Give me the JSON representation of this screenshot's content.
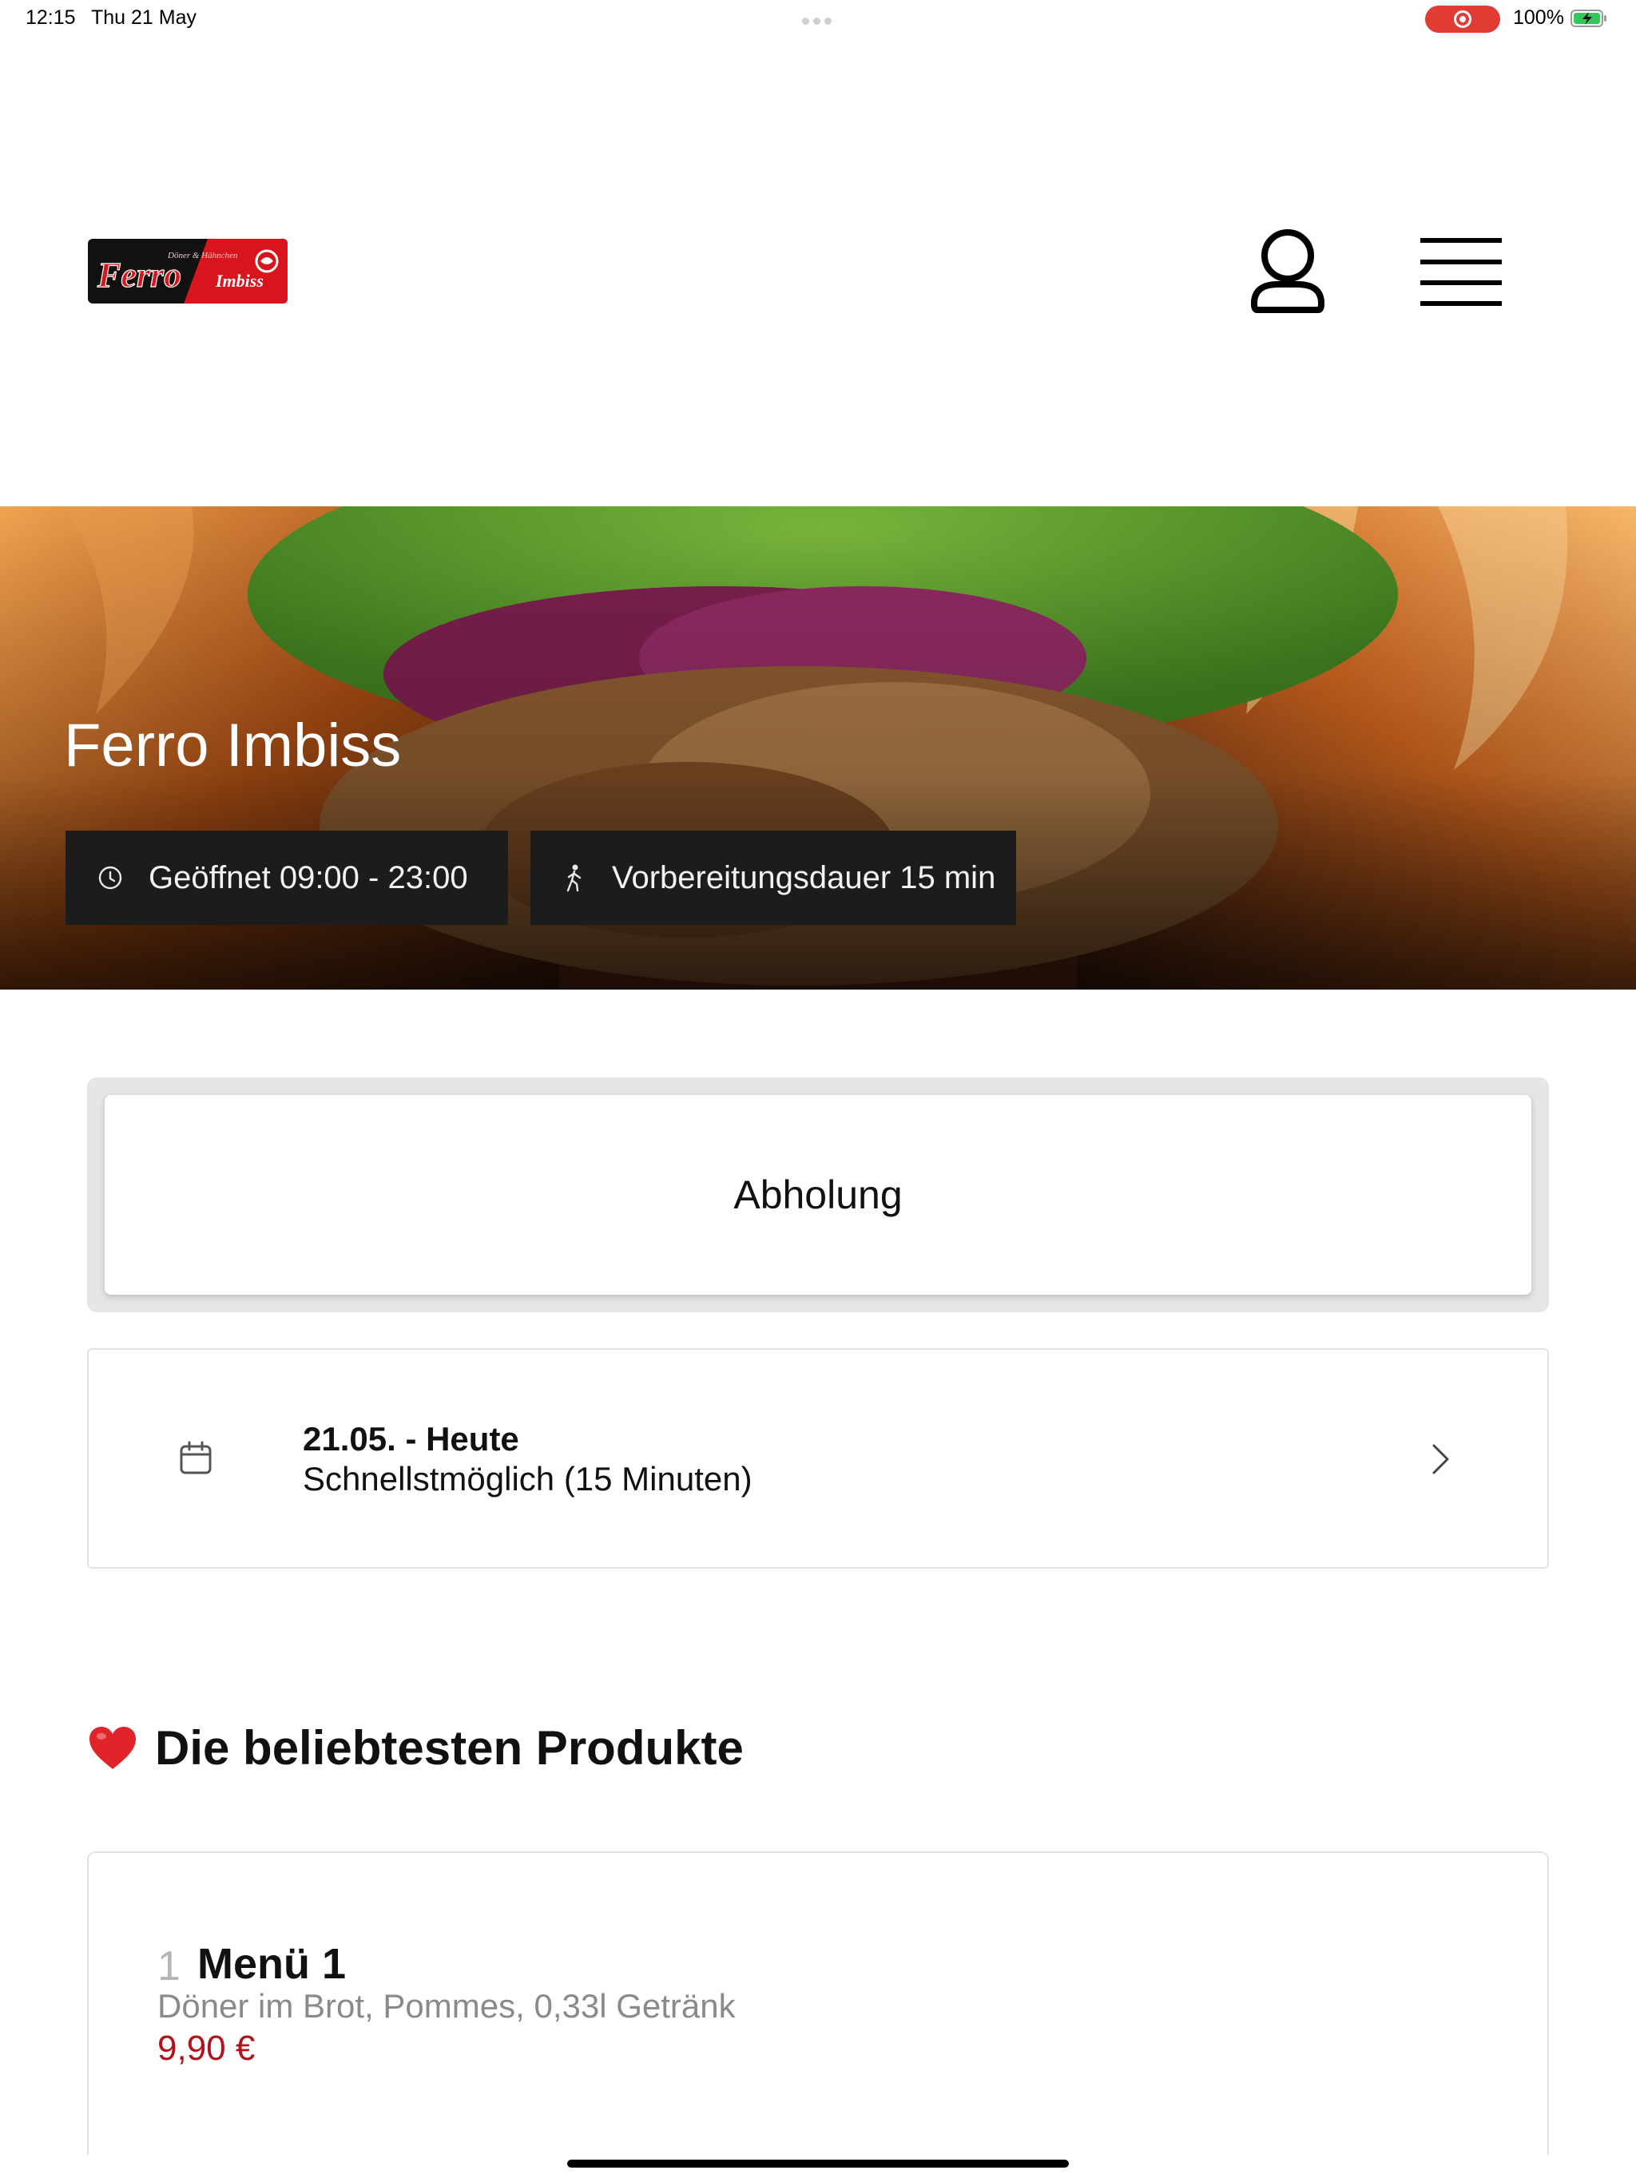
{
  "status_bar": {
    "time": "12:15",
    "date": "Thu 21 May",
    "battery": "100%"
  },
  "header": {
    "logo_small_text": "Döner & Hähnchen",
    "logo_main": "Ferro",
    "logo_sub": "Imbiss",
    "icons": [
      "user-icon",
      "hamburger-menu-icon"
    ]
  },
  "hero": {
    "title": "Ferro Imbiss",
    "opening": "Geöffnet 09:00 - 23:00",
    "prep": "Vorbereitungsdauer 15 min"
  },
  "order_mode": {
    "selected": "Abholung"
  },
  "pickup_time": {
    "date_label": "21.05. - Heute",
    "time_label": "Schnellstmöglich (15 Minuten)"
  },
  "popular": {
    "title": "Die beliebtesten Produkte",
    "items": [
      {
        "rank": "1",
        "name": "Menü 1",
        "description": "Döner im Brot, Pommes, 0,33l Getränk",
        "price": "9,90 €"
      }
    ]
  },
  "colors": {
    "price": "#b3121b",
    "logo_red": "#d8141c",
    "recording": "#e23b34",
    "pill_bg": "#1c1c1c"
  }
}
